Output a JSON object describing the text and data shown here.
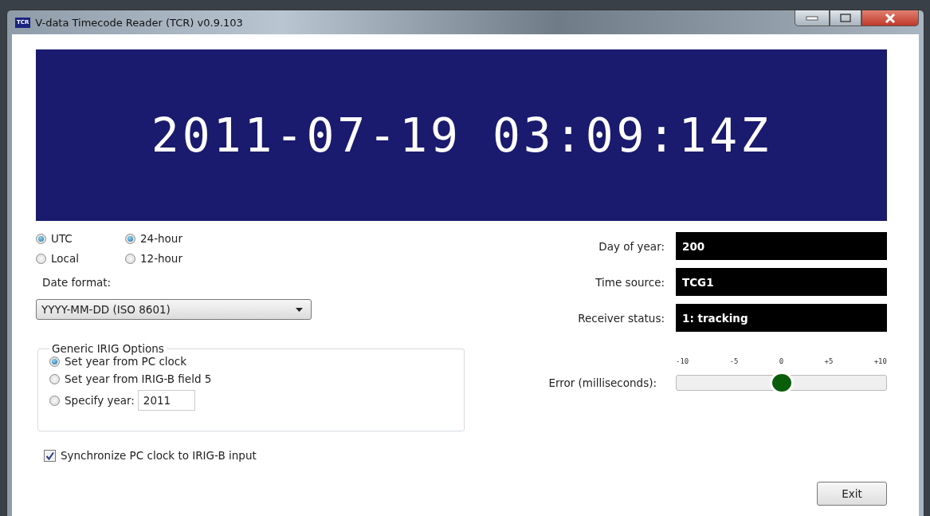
{
  "window": {
    "title": "V-data Timecode Reader (TCR) v0.9.103",
    "icon_text": "TCR"
  },
  "display": {
    "time": "2011-07-19 03:09:14Z"
  },
  "zone_options": [
    {
      "label": "UTC",
      "selected": true
    },
    {
      "label": "Local",
      "selected": false
    }
  ],
  "hour_options": [
    {
      "label": "24-hour",
      "selected": true
    },
    {
      "label": "12-hour",
      "selected": false
    }
  ],
  "date_format": {
    "label": "Date format:",
    "value": "YYYY-MM-DD (ISO 8601)"
  },
  "irig_options": {
    "title": "Generic IRIG Options",
    "items": [
      {
        "label": "Set year from PC clock",
        "selected": true
      },
      {
        "label": "Set year from IRIG-B field 5",
        "selected": false
      },
      {
        "label": "Specify year:",
        "selected": false,
        "year": "2011"
      }
    ]
  },
  "sync": {
    "label": "Synchronize PC clock to IRIG-B input",
    "checked": true
  },
  "status_fields": [
    {
      "label": "Day of year:",
      "value": "200"
    },
    {
      "label": "Time source:",
      "value": "TCG1"
    },
    {
      "label": "Receiver status:",
      "value": "1: tracking"
    }
  ],
  "error_meter": {
    "label": "Error (milliseconds):",
    "ticks": [
      "-10",
      "-5",
      "0",
      "+5",
      "+10"
    ],
    "level": 0.5
  },
  "buttons": [
    {
      "label": "Exit"
    }
  ]
}
